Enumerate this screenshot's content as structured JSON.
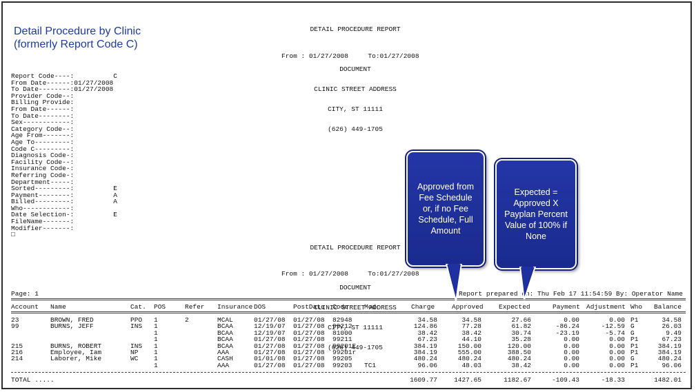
{
  "overlay_title": {
    "line1": "Detail Procedure by Clinic",
    "line2": "(formerly Report Code C)"
  },
  "report_header": {
    "title": "DETAIL PROCEDURE REPORT",
    "line1": "DOCUMENT",
    "line2": "CLINIC STREET ADDRESS",
    "line3": "CITY, ST 11111",
    "line4": "(626) 449-1705",
    "date_range": "From : 01/27/2008     To:01/27/2008"
  },
  "parameters": [
    {
      "label": "Report Code----:",
      "value": "          C"
    },
    {
      "label": "From Date------:",
      "value": "01/27/2008"
    },
    {
      "label": "To Date--------:",
      "value": "01/27/2008"
    },
    {
      "label": "Provider Code--:",
      "value": ""
    },
    {
      "label": "Billing Provide:",
      "value": ""
    },
    {
      "label": "From Date------:",
      "value": ""
    },
    {
      "label": "To Date--------:",
      "value": ""
    },
    {
      "label": "Sex------------:",
      "value": ""
    },
    {
      "label": "Category Code--:",
      "value": ""
    },
    {
      "label": "Age From-------:",
      "value": ""
    },
    {
      "label": "Age To---------:",
      "value": ""
    },
    {
      "label": "Code C---------:",
      "value": ""
    },
    {
      "label": "Diagnosis Code-:",
      "value": ""
    },
    {
      "label": "Facility Code--:",
      "value": ""
    },
    {
      "label": "Insurance Code-:",
      "value": ""
    },
    {
      "label": "Referring Code-:",
      "value": ""
    },
    {
      "label": "Department-----:",
      "value": ""
    },
    {
      "label": "Sorted---------:",
      "value": "          E"
    },
    {
      "label": "Payment--------:",
      "value": "          A"
    },
    {
      "label": "Billed---------:",
      "value": "          A"
    },
    {
      "label": "Who------------:",
      "value": ""
    },
    {
      "label": "Date Selection-:",
      "value": "          E"
    },
    {
      "label": "FileName-------:",
      "value": ""
    },
    {
      "label": "Modifier-------:",
      "value": ""
    },
    {
      "label": "□",
      "value": ""
    }
  ],
  "page_line": {
    "page": "Page: 1",
    "prepared": "Report prepared on: Thu Feb 17 11:54:59 By: Operator Name"
  },
  "columns": {
    "account": "Account",
    "name": "Name",
    "cat": "Cat.",
    "pos": "POS",
    "refer": "Refer",
    "insurance": "Insurance",
    "dos": "DOS",
    "postdate": "PostDate",
    "code": "Code",
    "mod": "Mod",
    "charge": "Charge",
    "approved": "Approved",
    "expected": "Expected",
    "payment": "Payment",
    "adjustment": "Adjustment",
    "who": "Who",
    "balance": "Balance"
  },
  "rows": [
    {
      "account": "23",
      "name": "BROWN, FRED",
      "cat": "PPO",
      "pos": "1",
      "refer": "2",
      "ins": "MCAL",
      "dos": "01/27/08",
      "post": "01/27/08",
      "code": "82948",
      "mod": "",
      "charge": "34.58",
      "approved": "34.58",
      "expected": "27.66",
      "payment": "0.00",
      "adjustment": "0.00",
      "who": "P1",
      "balance": "34.58"
    },
    {
      "account": "99",
      "name": "BURNS, JEFF",
      "cat": "INS",
      "pos": "1",
      "refer": "",
      "ins": "BCAA",
      "dos": "12/19/07",
      "post": "01/27/08",
      "code": "99212",
      "mod": "",
      "charge": "124.86",
      "approved": "77.28",
      "expected": "61.82",
      "payment": "-86.24",
      "adjustment": "-12.59",
      "who": "G",
      "balance": "26.03"
    },
    {
      "account": "",
      "name": "",
      "cat": "",
      "pos": "1",
      "refer": "",
      "ins": "BCAA",
      "dos": "12/19/07",
      "post": "01/27/08",
      "code": "81000",
      "mod": "",
      "charge": "38.42",
      "approved": "38.42",
      "expected": "30.74",
      "payment": "-23.19",
      "adjustment": "-5.74",
      "who": "G",
      "balance": "9.49"
    },
    {
      "account": "",
      "name": "",
      "cat": "",
      "pos": "1",
      "refer": "",
      "ins": "BCAA",
      "dos": "01/27/08",
      "post": "01/27/08",
      "code": "99211",
      "mod": "",
      "charge": "67.23",
      "approved": "44.10",
      "expected": "35.28",
      "payment": "0.00",
      "adjustment": "0.00",
      "who": "P1",
      "balance": "67.23"
    },
    {
      "account": "215",
      "name": "BURNS, ROBERT",
      "cat": "INS",
      "pos": "1",
      "refer": "",
      "ins": "BCAA",
      "dos": "01/27/08",
      "post": "01/27/08",
      "code": "99201E",
      "mod": "",
      "charge": "384.19",
      "approved": "150.00",
      "expected": "120.00",
      "payment": "0.00",
      "adjustment": "0.00",
      "who": "P1",
      "balance": "384.19"
    },
    {
      "account": "216",
      "name": "Employee, Iam",
      "cat": "NP",
      "pos": "1",
      "refer": "",
      "ins": "AAA",
      "dos": "01/27/08",
      "post": "01/27/08",
      "code": "99201r",
      "mod": "",
      "charge": "384.19",
      "approved": "555.00",
      "expected": "388.50",
      "payment": "0.00",
      "adjustment": "0.00",
      "who": "P1",
      "balance": "384.19"
    },
    {
      "account": "214",
      "name": "Laborer, Mike",
      "cat": "WC",
      "pos": "1",
      "refer": "",
      "ins": "CASH",
      "dos": "01/01/08",
      "post": "01/27/08",
      "code": "99205",
      "mod": "",
      "charge": "480.24",
      "approved": "480.24",
      "expected": "480.24",
      "payment": "0.00",
      "adjustment": "0.00",
      "who": "G",
      "balance": "480.24"
    },
    {
      "account": "",
      "name": "",
      "cat": "",
      "pos": "1",
      "refer": "",
      "ins": "AAA",
      "dos": "01/27/08",
      "post": "01/27/08",
      "code": "99203",
      "mod": "TC1",
      "charge": "96.06",
      "approved": "48.03",
      "expected": "38.42",
      "payment": "0.00",
      "adjustment": "0.00",
      "who": "P1",
      "balance": "96.06"
    }
  ],
  "totals": {
    "label": "TOTAL .....",
    "charge": "1609.77",
    "approved": "1427.65",
    "expected": "1182.67",
    "payment": "-109.43",
    "adjustment": "-18.33",
    "balance": "1482.01"
  },
  "callouts": {
    "approved": "Approved from Fee Schedule or, if no Fee Schedule, Full Amount",
    "expected": "Expected = Approved X Payplan Percent Value of 100% if None"
  },
  "colors": {
    "callout_fill": "#1f30a0",
    "title_blue": "#1c3aa9"
  }
}
